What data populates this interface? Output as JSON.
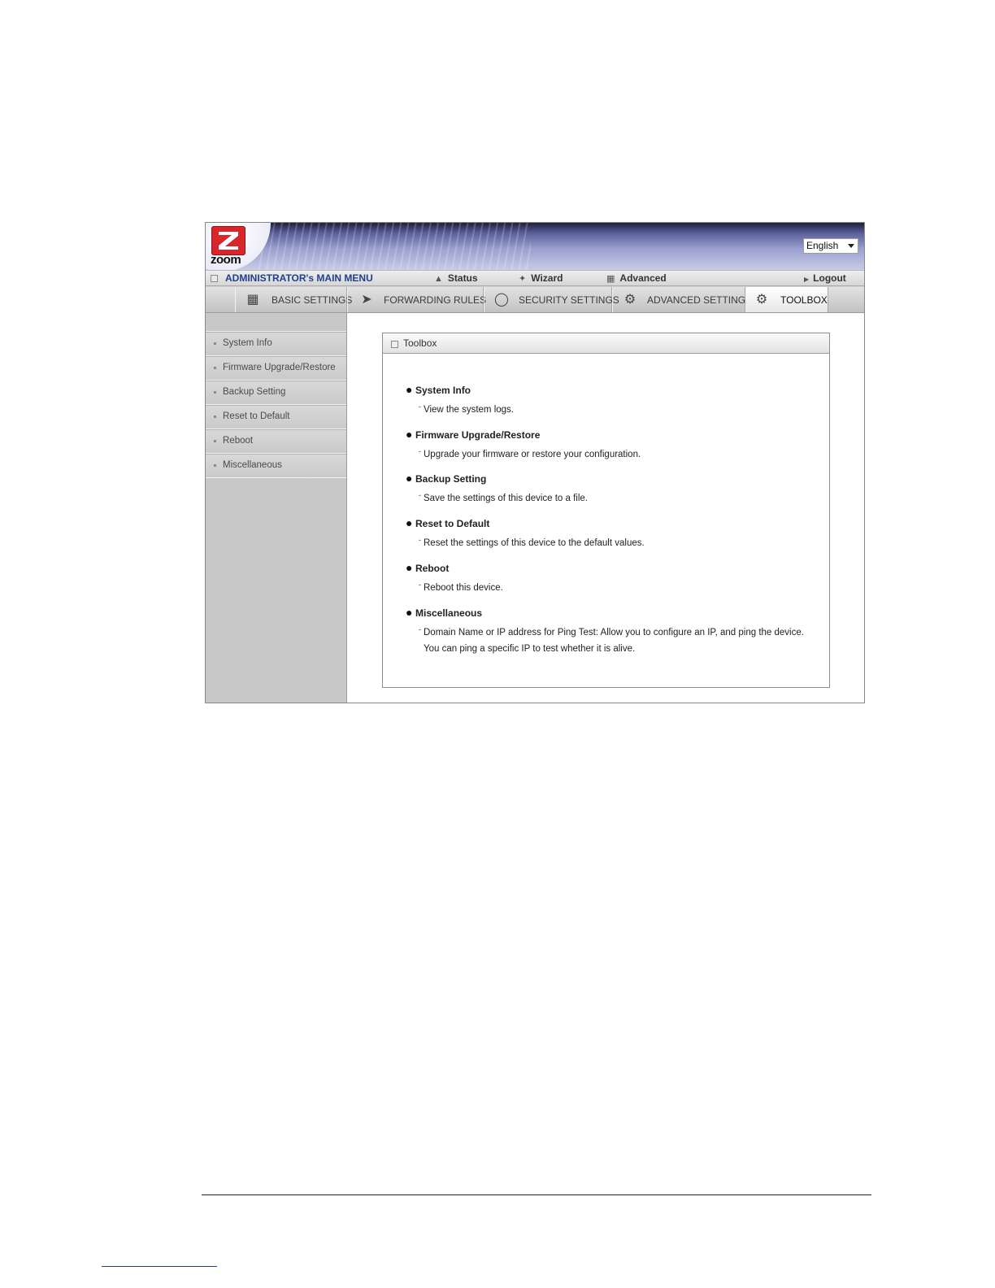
{
  "banner": {
    "logo_text": "zoom",
    "language": "English"
  },
  "menubar": {
    "title": "ADMINISTRATOR's MAIN MENU",
    "links": [
      {
        "label": "Status",
        "icon": "status-icon"
      },
      {
        "label": "Wizard",
        "icon": "wizard-icon"
      },
      {
        "label": "Advanced",
        "icon": "advanced-icon"
      },
      {
        "label": "Logout",
        "icon": "arrow-right-icon"
      }
    ]
  },
  "tabs": [
    {
      "label": "BASIC SETTINGS",
      "icon": "basic-settings-icon"
    },
    {
      "label": "FORWARDING RULES",
      "icon": "forwarding-rules-icon"
    },
    {
      "label": "SECURITY SETTINGS",
      "icon": "security-settings-icon"
    },
    {
      "label": "ADVANCED SETTINGS",
      "icon": "advanced-settings-icon"
    },
    {
      "label": "TOOLBOX",
      "icon": "toolbox-icon",
      "active": true
    }
  ],
  "sidebar": {
    "items": [
      {
        "label": "System Info"
      },
      {
        "label": "Firmware Upgrade/Restore"
      },
      {
        "label": "Backup Setting"
      },
      {
        "label": "Reset to Default"
      },
      {
        "label": "Reboot"
      },
      {
        "label": "Miscellaneous"
      }
    ]
  },
  "panel": {
    "title": "Toolbox",
    "entries": [
      {
        "name": "System Info",
        "desc": "View the system logs."
      },
      {
        "name": "Firmware Upgrade/Restore",
        "desc": "Upgrade your firmware or restore your configuration."
      },
      {
        "name": "Backup Setting",
        "desc": "Save the settings of this device to a file."
      },
      {
        "name": "Reset to Default",
        "desc": "Reset the settings of this device to the default values."
      },
      {
        "name": "Reboot",
        "desc": "Reboot this device."
      },
      {
        "name": "Miscellaneous",
        "desc": "Domain Name or IP address for Ping Test: Allow you to configure an IP, and ping the device. You can ping a specific IP to test whether it is alive."
      }
    ]
  },
  "colors": {
    "accent": "#1f3f8e",
    "logo_red": "#d8262b",
    "sidebar": "#c8c8c8"
  }
}
